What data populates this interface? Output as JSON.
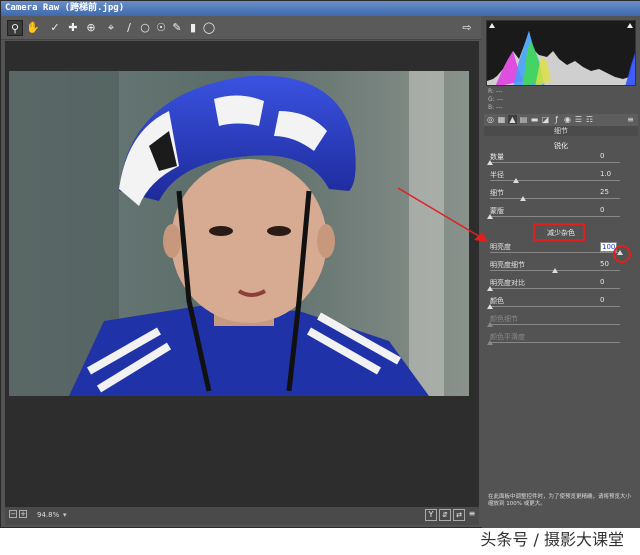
{
  "window": {
    "title": "Camera Raw (跨梯前.jpg)"
  },
  "toolbar": {
    "tools": [
      "zoom-tool",
      "hand-tool",
      "white-balance-tool",
      "color-sampler-tool",
      "target-adjustment-tool",
      "crop-tool",
      "straighten-tool",
      "spot-removal-tool",
      "red-eye-tool",
      "adjustment-brush",
      "graduated-filter",
      "radial-filter"
    ]
  },
  "status": {
    "zoom": "94.8%"
  },
  "rgb": {
    "r": "R: ---",
    "g": "G: ---",
    "b": "B: ---"
  },
  "panel": {
    "title": "细节"
  },
  "sharpen": {
    "title": "锐化",
    "amount": {
      "label": "数量",
      "value": "0",
      "level": 0
    },
    "radius": {
      "label": "半径",
      "value": "1.0",
      "level": 0.2
    },
    "detail": {
      "label": "细节",
      "value": "25",
      "level": 0.25
    },
    "masking": {
      "label": "蒙版",
      "value": "0",
      "level": 0
    }
  },
  "noise": {
    "title": "减少杂色",
    "luminance": {
      "label": "明亮度",
      "value": "100",
      "level": 1.0
    },
    "luminance_detail": {
      "label": "明亮度细节",
      "value": "50",
      "level": 0.5
    },
    "luminance_contrast": {
      "label": "明亮度对比",
      "value": "0",
      "level": 0
    },
    "color": {
      "label": "颜色",
      "value": "0",
      "level": 0
    },
    "color_detail": {
      "label": "颜色细节",
      "value": "",
      "level": 0
    },
    "color_smoothness": {
      "label": "颜色平滑度",
      "value": "",
      "level": 0
    }
  },
  "footnote": "在此面板中调整控件时，为了使预览更精确，请将预览大小缩放到 100% 或更大。",
  "watermark": "头条号 / 摄影大课堂",
  "colors": {
    "helmet": "#2b3fc7",
    "shirt": "#2034a8",
    "highlight": "#e02020"
  }
}
